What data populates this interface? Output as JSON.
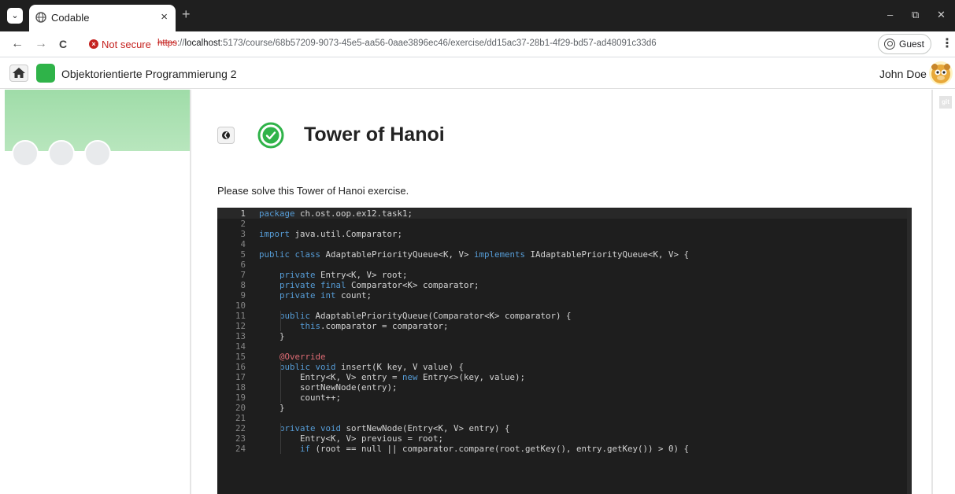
{
  "browser": {
    "tab_title": "Codable",
    "new_tab": "+",
    "tab_close": "×",
    "menu_glyph": "⌄",
    "window": {
      "minimize": "–",
      "restore": "⧉",
      "close": "✕"
    },
    "nav": {
      "back": "←",
      "forward": "→",
      "reload": "C"
    },
    "security_text": "Not secure",
    "url_scheme": "https",
    "url_sep": "://",
    "url_host": "localhost",
    "url_rest": ":5173/course/68b57209-9073-45e5-aa56-0aae3896ec46/exercise/dd15ac37-28b1-4f29-bd57-ad48091c33d6",
    "profile_label": "Guest",
    "menu_dots": "⋮",
    "colors": {
      "tabstrip": "#1f1f1f",
      "insecure": "#c5221f"
    }
  },
  "header": {
    "course_title": "Objektorientierte Programmierung 2",
    "user_name": "John Doe",
    "course_color": "#2fb349"
  },
  "right_rail": {
    "tag": "git"
  },
  "exercise": {
    "back_glyph": "❮",
    "title": "Tower of Hanoi",
    "description": "Please solve this Tower of Hanoi exercise.",
    "status_color": "#2fb349"
  },
  "editor": {
    "lines": [
      [
        {
          "t": "package",
          "c": "kw"
        },
        {
          "t": " ch.ost.oop.ex12.task1;"
        }
      ],
      [],
      [
        {
          "t": "import",
          "c": "kw"
        },
        {
          "t": " java.util.Comparator;"
        }
      ],
      [],
      [
        {
          "t": "public class",
          "c": "kw"
        },
        {
          "t": " AdaptablePriorityQueue<K, V> "
        },
        {
          "t": "implements",
          "c": "kw"
        },
        {
          "t": " IAdaptablePriorityQueue<K, V> {"
        }
      ],
      [],
      [
        {
          "t": "    "
        },
        {
          "t": "private",
          "c": "kw"
        },
        {
          "t": " Entry<K, V> root;"
        }
      ],
      [
        {
          "t": "    "
        },
        {
          "t": "private final",
          "c": "kw"
        },
        {
          "t": " Comparator<K> comparator;"
        }
      ],
      [
        {
          "t": "    "
        },
        {
          "t": "private int",
          "c": "kw"
        },
        {
          "t": " count;"
        }
      ],
      [],
      [
        {
          "t": "    "
        },
        {
          "t": "public",
          "c": "kw"
        },
        {
          "t": " AdaptablePriorityQueue(Comparator<K> comparator) {"
        }
      ],
      [
        {
          "t": "        "
        },
        {
          "t": "this",
          "c": "kw"
        },
        {
          "t": ".comparator = comparator;"
        }
      ],
      [
        {
          "t": "    }"
        }
      ],
      [],
      [
        {
          "t": "    "
        },
        {
          "t": "@Override",
          "c": "ann"
        }
      ],
      [
        {
          "t": "    "
        },
        {
          "t": "public void",
          "c": "kw"
        },
        {
          "t": " insert(K key, V value) {"
        }
      ],
      [
        {
          "t": "        Entry<K, V> entry = "
        },
        {
          "t": "new",
          "c": "kw"
        },
        {
          "t": " Entry<>(key, value);"
        }
      ],
      [
        {
          "t": "        sortNewNode(entry);"
        }
      ],
      [
        {
          "t": "        count++;"
        }
      ],
      [
        {
          "t": "    }"
        }
      ],
      [],
      [
        {
          "t": "    "
        },
        {
          "t": "private void",
          "c": "kw"
        },
        {
          "t": " sortNewNode(Entry<K, V> entry) {"
        }
      ],
      [
        {
          "t": "        Entry<K, V> previous = root;"
        }
      ],
      [
        {
          "t": "        "
        },
        {
          "t": "if",
          "c": "kw"
        },
        {
          "t": " (root == null || comparator.compare(root.getKey(), entry.getKey()) > 0) {"
        }
      ]
    ]
  }
}
